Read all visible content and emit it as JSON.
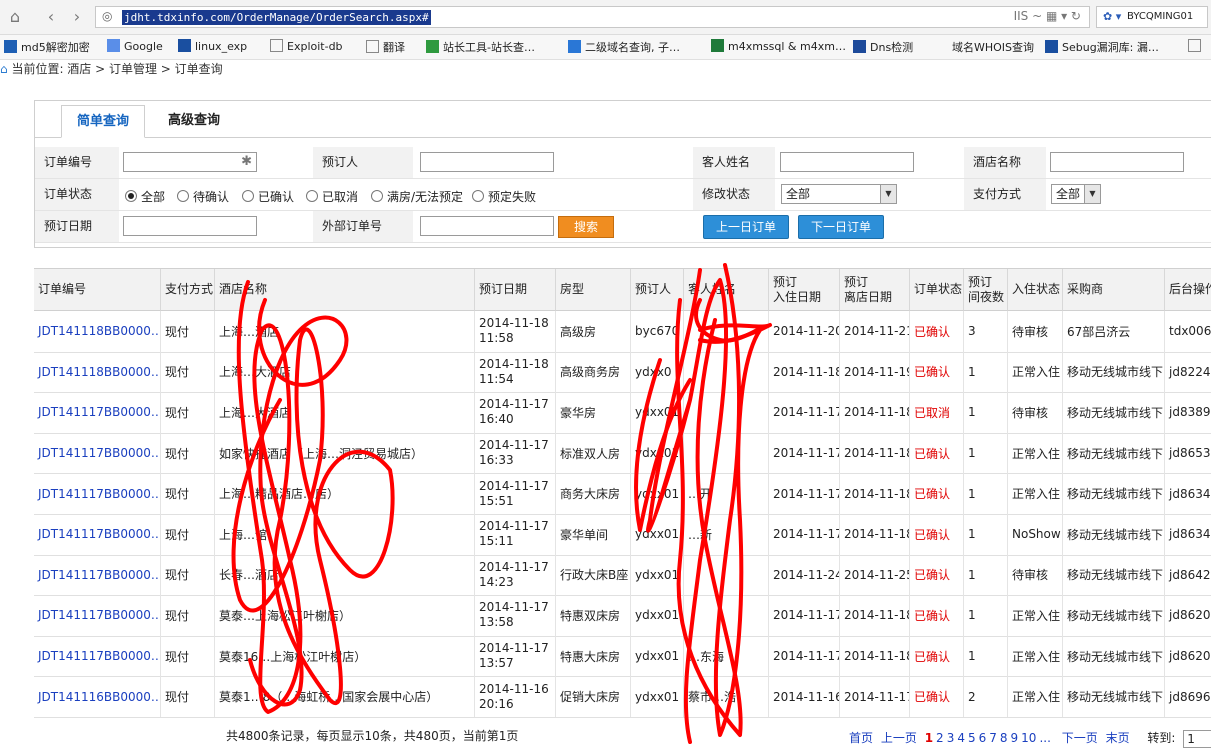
{
  "browser": {
    "url": "jdht.tdxinfo.com/OrderManage/OrderSearch.aspx#",
    "profile_name": "BYCQMING01"
  },
  "bookmarks": [
    {
      "label": "md5解密加密",
      "icon": "grid-icon"
    },
    {
      "label": "Google",
      "icon": "google-icon"
    },
    {
      "label": "linux_exp",
      "icon": "s-icon"
    },
    {
      "label": "Exploit-db",
      "icon": "page-icon"
    },
    {
      "label": "翻译",
      "icon": "page-icon"
    },
    {
      "label": "站长工具-站长查…",
      "icon": "tool-icon"
    },
    {
      "label": "二级域名查询, 子…",
      "icon": "p-icon"
    },
    {
      "label": "m4xmssql & m4xm…",
      "icon": "x-icon"
    },
    {
      "label": "Dns检测",
      "icon": "d-icon"
    },
    {
      "label": "域名WHOIS查询",
      "icon": "none"
    },
    {
      "label": "Sebug漏洞库: 漏…",
      "icon": "s-icon"
    },
    {
      "label": "",
      "icon": "page-icon"
    }
  ],
  "breadcrumb": "当前位置: 酒店 > 订单管理 > 订单查询",
  "tabs": [
    {
      "label": "简单查询",
      "active": true
    },
    {
      "label": "高级查询",
      "active": false
    }
  ],
  "form": {
    "order_no_label": "订单编号",
    "booker_label": "预订人",
    "guest_name_label": "客人姓名",
    "hotel_name_label": "酒店名称",
    "order_status_label": "订单状态",
    "status_options": [
      {
        "label": "全部",
        "checked": true
      },
      {
        "label": "待确认",
        "checked": false
      },
      {
        "label": "已确认",
        "checked": false
      },
      {
        "label": "已取消",
        "checked": false
      },
      {
        "label": "满房/无法预定",
        "checked": false
      },
      {
        "label": "预定失败",
        "checked": false
      }
    ],
    "modify_status_label": "修改状态",
    "modify_status_value": "全部",
    "payment_label": "支付方式",
    "payment_value": "全部",
    "booking_date_label": "预订日期",
    "external_order_label": "外部订单号",
    "search_button": "搜索",
    "prev_day_button": "上一日订单",
    "next_day_button": "下一日订单"
  },
  "table": {
    "headers": [
      "订单编号",
      "支付方式",
      "酒店名称",
      "预订日期",
      "房型",
      "预订人",
      "客人姓名",
      "预订\n入住日期",
      "预订\n离店日期",
      "订单状态",
      "预订\n间夜数",
      "入住状态",
      "采购商",
      "后台操作"
    ],
    "rows": [
      [
        "JDT141118BB0000…",
        "现付",
        "上海…酒店",
        "2014-11-18\n11:58",
        "高级房",
        "byc670",
        "",
        "2014-11-20",
        "2014-11-21",
        "已确认",
        "3",
        "待审核",
        "67部吕济云",
        "tdx006"
      ],
      [
        "JDT141118BB0000…",
        "现付",
        "上海…大酒店",
        "2014-11-18\n11:54",
        "高级商务房",
        "ydxx0",
        "",
        "2014-11-18",
        "2014-11-19",
        "已确认",
        "1",
        "正常入住",
        "移动无线城市线下",
        "jd8224"
      ],
      [
        "JDT141117BB0000…",
        "现付",
        "上海…大酒店",
        "2014-11-17\n16:40",
        "豪华房",
        "ydxx01",
        "",
        "2014-11-17",
        "2014-11-18",
        "已取消",
        "1",
        "待审核",
        "移动无线城市线下",
        "jd8389"
      ],
      [
        "JDT141117BB0000…",
        "现付",
        "如家快捷酒店（上海…洞泾贸易城店）",
        "2014-11-17\n16:33",
        "标准双人房",
        "ydxx01",
        "",
        "2014-11-17",
        "2014-11-18",
        "已确认",
        "1",
        "正常入住",
        "移动无线城市线下",
        "jd8653"
      ],
      [
        "JDT141117BB0000…",
        "现付",
        "上海…精品酒店…店）",
        "2014-11-17\n15:51",
        "商务大床房",
        "ydxx01",
        "…开",
        "2014-11-17",
        "2014-11-18",
        "已确认",
        "1",
        "正常入住",
        "移动无线城市线下",
        "jd8634"
      ],
      [
        "JDT141117BB0000…",
        "现付",
        "上海…馆",
        "2014-11-17\n15:11",
        "豪华单间",
        "ydxx01",
        "…新",
        "2014-11-17",
        "2014-11-18",
        "已确认",
        "1",
        "NoShow",
        "移动无线城市线下",
        "jd8634"
      ],
      [
        "JDT141117BB0000…",
        "现付",
        "长春…酒店",
        "2014-11-17\n14:23",
        "行政大床B座",
        "ydxx01",
        "",
        "2014-11-24",
        "2014-11-25",
        "已确认",
        "1",
        "待审核",
        "移动无线城市线下",
        "jd8642"
      ],
      [
        "JDT141117BB0000…",
        "现付",
        "莫泰…上海松江叶榭店）",
        "2014-11-17\n13:58",
        "特惠双床房",
        "ydxx01",
        "",
        "2014-11-17",
        "2014-11-18",
        "已确认",
        "1",
        "正常入住",
        "移动无线城市线下",
        "jd8620"
      ],
      [
        "JDT141117BB0000…",
        "现付",
        "莫泰16…上海松江叶榭店）",
        "2014-11-17\n13:57",
        "特惠大床房",
        "ydxx01",
        "…东海",
        "2014-11-17",
        "2014-11-18",
        "已确认",
        "1",
        "正常入住",
        "移动无线城市线下",
        "jd8620"
      ],
      [
        "JDT141116BB0000…",
        "现付",
        "莫泰1…8（…海虹桥…国家会展中心店）",
        "2014-11-16\n20:16",
        "促销大床房",
        "ydxx01",
        "蔡市…浩",
        "2014-11-16",
        "2014-11-17",
        "已确认",
        "2",
        "正常入住",
        "移动无线城市线下",
        "jd8696"
      ]
    ]
  },
  "footer": {
    "summary": "共4800条记录，每页显示10条，共480页，当前第1页",
    "first": "首页",
    "prev": "上一页",
    "pages": [
      "1",
      "2",
      "3",
      "4",
      "5",
      "6",
      "7",
      "8",
      "9",
      "10",
      "..."
    ],
    "next": "下一页",
    "last": "末页",
    "goto_label": "转到:",
    "goto_value": "1"
  },
  "colors": {
    "link": "#1a3fbf",
    "status_red": "#e00000",
    "scribble": "#ff0000",
    "button_blue": "#2d8fd8",
    "button_orange": "#f08d20"
  }
}
